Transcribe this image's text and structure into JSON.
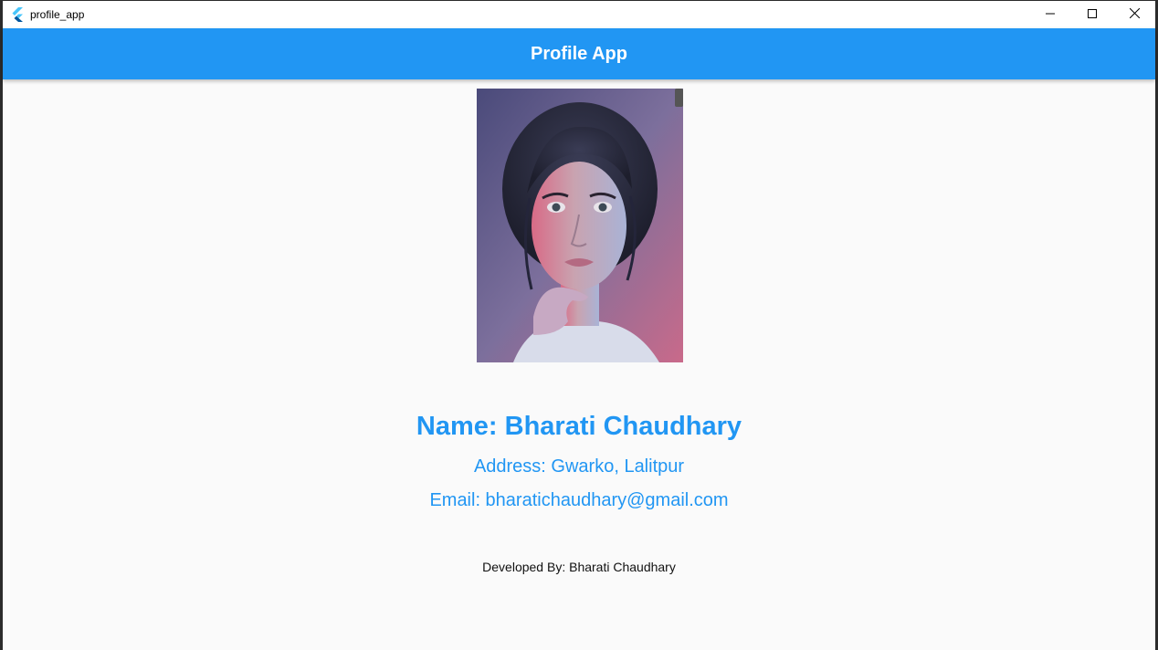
{
  "window": {
    "title": "profile_app",
    "controls": {
      "minimize": "minimize-icon",
      "maximize": "maximize-icon",
      "close": "close-icon"
    }
  },
  "appbar": {
    "title": "Profile App",
    "color": "#2196f3"
  },
  "profile": {
    "photo_alt": "",
    "name": "Name: Bharati Chaudhary",
    "address": "Address: Gwarko, Lalitpur",
    "email": "Email: bharatichaudhary@gmail.com",
    "text_color": "#2196f3"
  },
  "footer": {
    "credit": "Developed By: Bharati Chaudhary"
  }
}
